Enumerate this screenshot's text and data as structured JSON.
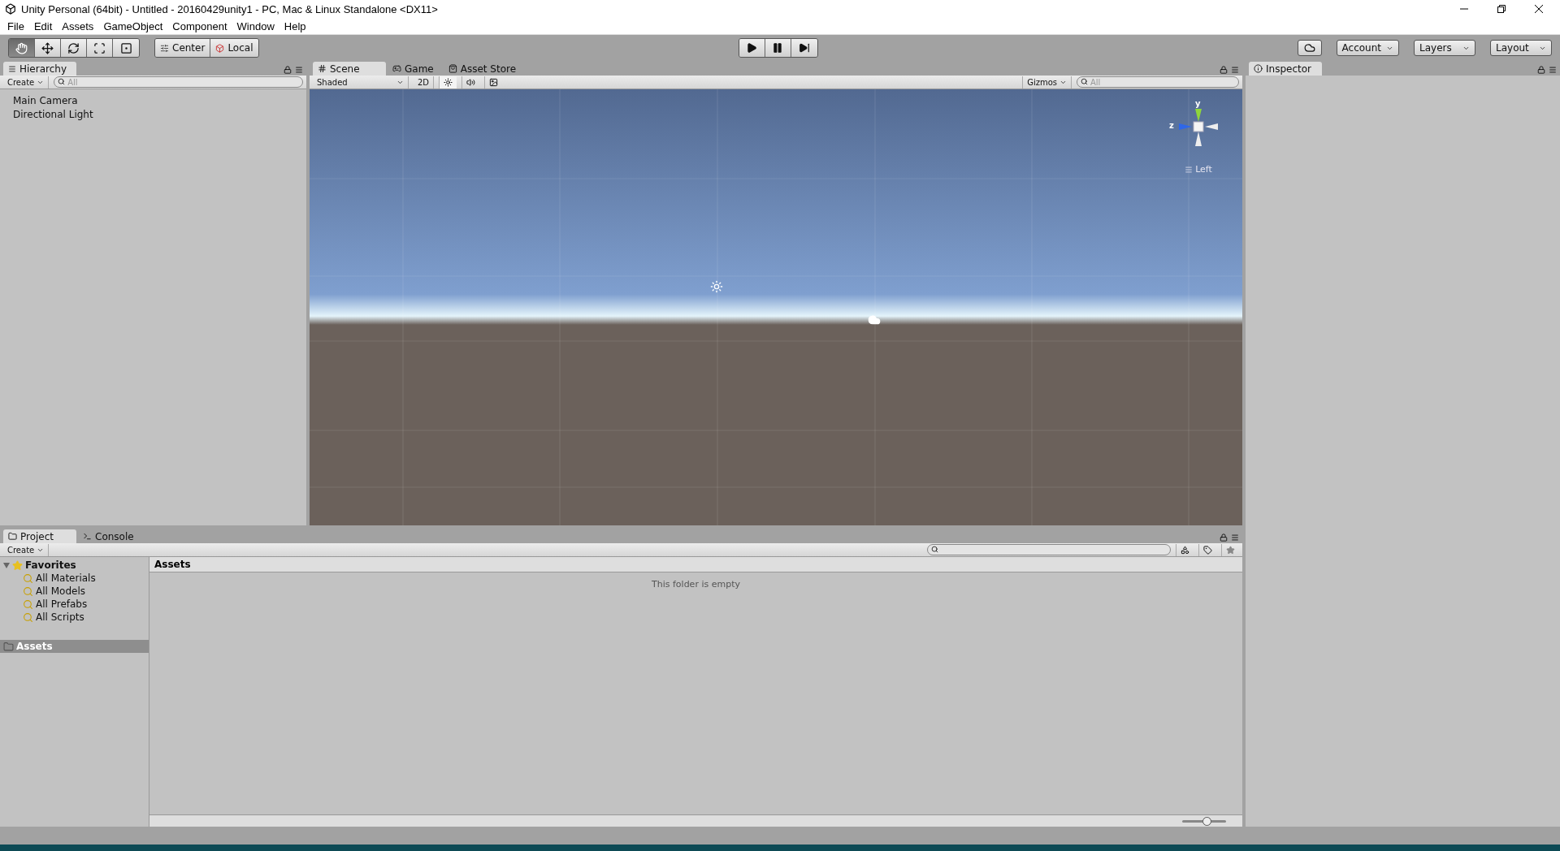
{
  "window": {
    "title": "Unity Personal (64bit) - Untitled - 20160429unity1 - PC, Mac & Linux Standalone <DX11>"
  },
  "menu": [
    "File",
    "Edit",
    "Assets",
    "GameObject",
    "Component",
    "Window",
    "Help"
  ],
  "tools": [
    {
      "kind": "hand",
      "selected": true
    },
    {
      "kind": "move",
      "selected": false
    },
    {
      "kind": "rotate",
      "selected": false
    },
    {
      "kind": "scale",
      "selected": false
    },
    {
      "kind": "rect",
      "selected": false
    }
  ],
  "pivot_buttons": [
    {
      "kind": "pivot",
      "label": "Center"
    },
    {
      "kind": "space",
      "label": "Local"
    }
  ],
  "play_controls": [
    {
      "kind": "play"
    },
    {
      "kind": "pause"
    },
    {
      "kind": "step"
    }
  ],
  "right_buttons": [
    "Account",
    "Layers",
    "Layout"
  ],
  "hierarchy": {
    "tab": "Hierarchy",
    "create": "Create",
    "search": {
      "placeholder": "All"
    },
    "items": [
      "Main Camera",
      "Directional Light"
    ]
  },
  "scene_tabs": [
    {
      "kind": "scene",
      "label": "Scene",
      "selected": true
    },
    {
      "kind": "game",
      "label": "Game",
      "selected": false
    },
    {
      "kind": "store",
      "label": "Asset Store",
      "selected": false
    }
  ],
  "scene_toolbar": {
    "shading": "Shaded",
    "mode_2d": "2D",
    "lighting_on": true,
    "audio_on": false,
    "gizmos": "Gizmos",
    "search": {
      "placeholder": "All"
    }
  },
  "scene_gizmo": {
    "y_label": "y",
    "z_label": "z",
    "view": "Left"
  },
  "inspector": {
    "tab": "Inspector"
  },
  "bottom_tabs": [
    {
      "kind": "project",
      "label": "Project",
      "selected": true
    },
    {
      "kind": "console",
      "label": "Console",
      "selected": false
    }
  ],
  "project": {
    "create": "Create",
    "tree": [
      {
        "label": "Favorites",
        "kind": "favorites",
        "expanded": true,
        "selected": false,
        "children": [
          {
            "label": "All Materials",
            "kind": "search",
            "selected": false
          },
          {
            "label": "All Models",
            "kind": "search",
            "selected": false
          },
          {
            "label": "All Prefabs",
            "kind": "search",
            "selected": false
          },
          {
            "label": "All Scripts",
            "kind": "search",
            "selected": false
          }
        ]
      },
      {
        "label": "Assets",
        "kind": "folder",
        "selected": true
      }
    ],
    "breadcrumb": "Assets",
    "empty_message": "This folder is empty",
    "zoom_slider": {
      "level": 0.55
    }
  }
}
